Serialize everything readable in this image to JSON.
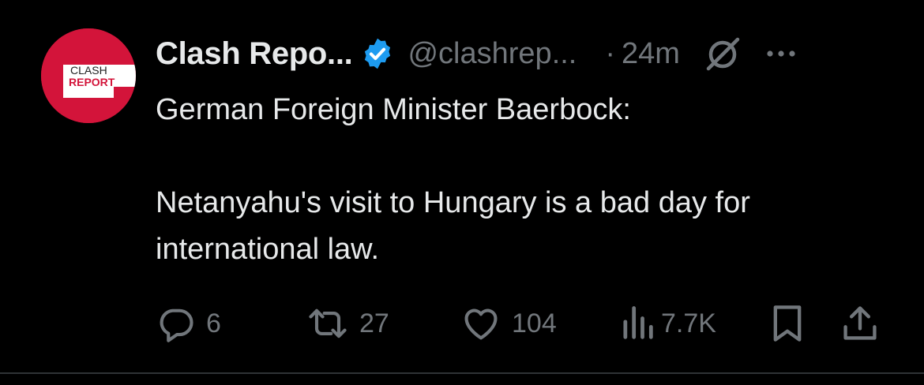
{
  "author": {
    "display_name": "Clash Repo...",
    "handle": "@clashrep...",
    "separator": "·",
    "time": "24m",
    "avatar_text_line1": "CLASH",
    "avatar_text_line2": "REPORT",
    "verified": true
  },
  "tweet": {
    "line1": "German Foreign Minister Baerbock:",
    "line2": "Netanyahu's visit to Hungary is a bad day for",
    "line3": "international law."
  },
  "actions": {
    "replies": "6",
    "reposts": "27",
    "likes": "104",
    "views": "7.7K"
  },
  "icons": {
    "verified": "verified-badge-icon",
    "grok": "grok-icon",
    "more": "more-icon",
    "reply": "reply-icon",
    "repost": "repost-icon",
    "like": "like-icon",
    "views": "views-icon",
    "bookmark": "bookmark-icon",
    "share": "share-icon"
  },
  "colors": {
    "background": "#000000",
    "text": "#e7e9ea",
    "muted": "#71767b",
    "verified": "#1d9bf0",
    "avatar": "#d3143a",
    "divider": "#2f3336"
  }
}
